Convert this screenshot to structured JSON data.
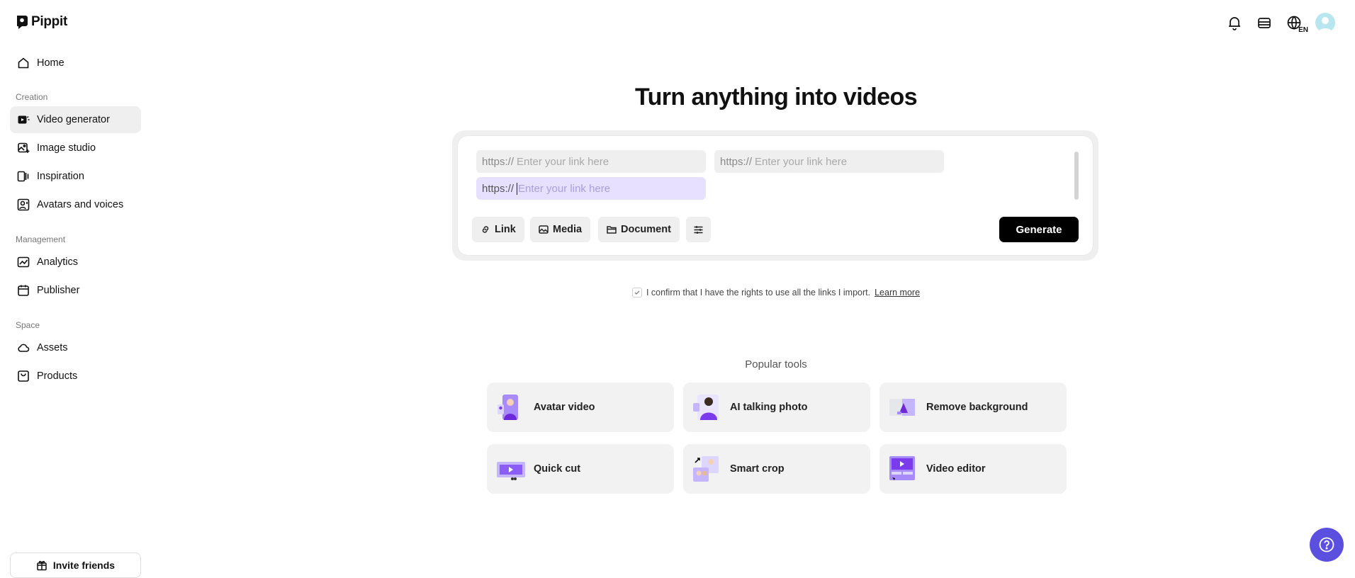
{
  "app": {
    "name": "Pippit"
  },
  "sidebar": {
    "home": "Home",
    "sections": [
      {
        "label": "Creation",
        "items": [
          "Video generator",
          "Image studio",
          "Inspiration",
          "Avatars and voices"
        ]
      },
      {
        "label": "Management",
        "items": [
          "Analytics",
          "Publisher"
        ]
      },
      {
        "label": "Space",
        "items": [
          "Assets",
          "Products"
        ]
      }
    ],
    "active_item": "Video generator",
    "invite_label": "Invite friends"
  },
  "header": {
    "language": "EN"
  },
  "main": {
    "headline": "Turn anything into videos",
    "link_fields": [
      {
        "prefix": "https://",
        "placeholder": "Enter your link here"
      },
      {
        "prefix": "https://",
        "placeholder": "Enter your link here"
      },
      {
        "prefix": "https://",
        "placeholder": "Enter your link here"
      }
    ],
    "tools": {
      "link": "Link",
      "media": "Media",
      "document": "Document"
    },
    "generate_label": "Generate",
    "confirm_text": "I confirm that I have the rights to use all the links I import.",
    "learn_more": "Learn more",
    "popular_title": "Popular tools",
    "popular_tools": [
      "Avatar video",
      "AI talking photo",
      "Remove background",
      "Quick cut",
      "Smart crop",
      "Video editor"
    ]
  },
  "colors": {
    "accent": "#5b4fe0",
    "active_field": "#e7e1ff",
    "primary_button": "#000000"
  }
}
